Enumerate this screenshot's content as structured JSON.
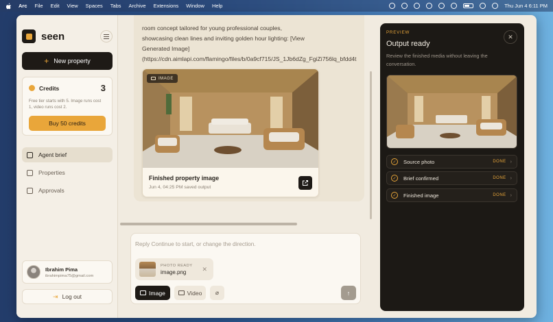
{
  "menubar": {
    "items": [
      "Arc",
      "File",
      "Edit",
      "View",
      "Spaces",
      "Tabs",
      "Archive",
      "Extensions",
      "Window",
      "Help"
    ],
    "clock": "Thu Jun 4  6:11 PM"
  },
  "sidebar": {
    "app_name": "seen",
    "new_property": "New property",
    "credits": {
      "label": "Credits",
      "count": "3",
      "description": "Free tier starts with 5. Image runs cost 1, video runs cost 2.",
      "buy_label": "Buy 50 credits"
    },
    "nav": [
      {
        "label": "Agent brief",
        "active": true
      },
      {
        "label": "Properties",
        "active": false
      },
      {
        "label": "Approvals",
        "active": false
      }
    ],
    "user": {
      "name": "Ibrahim Pima",
      "email": "ibrahimpima75@gmail.com"
    },
    "logout": "Log out"
  },
  "chat": {
    "message": "room concept tailored for young professional couples,\nshowcasing clean lines and inviting golden hour lighting: [View\nGenerated Image]\n(https://cdn.aimlapi.com/flamingo/files/b/0a9cf715/JS_1Jb6dZg_FgiZi756lq_bfdd4t",
    "card": {
      "badge": "IMAGE",
      "title": "Finished property image",
      "subtitle": "Jun 4, 04:25 PM saved output"
    }
  },
  "composer": {
    "placeholder": "Reply Continue to start, or change the direction.",
    "attachment": {
      "status": "PHOTO READY",
      "filename": "image.png"
    },
    "image_label": "Image",
    "video_label": "Video"
  },
  "preview": {
    "tag": "PREVIEW",
    "title": "Output ready",
    "description": "Review the finished media without leaving the conversation.",
    "steps": [
      {
        "label": "Source photo",
        "status": "DONE"
      },
      {
        "label": "Brief confirmed",
        "status": "DONE"
      },
      {
        "label": "Finished image",
        "status": "DONE"
      }
    ]
  },
  "colors": {
    "accent": "#e9a63a",
    "dark": "#1e1a16",
    "panel": "#1c1915",
    "background": "#f1ebe0"
  }
}
